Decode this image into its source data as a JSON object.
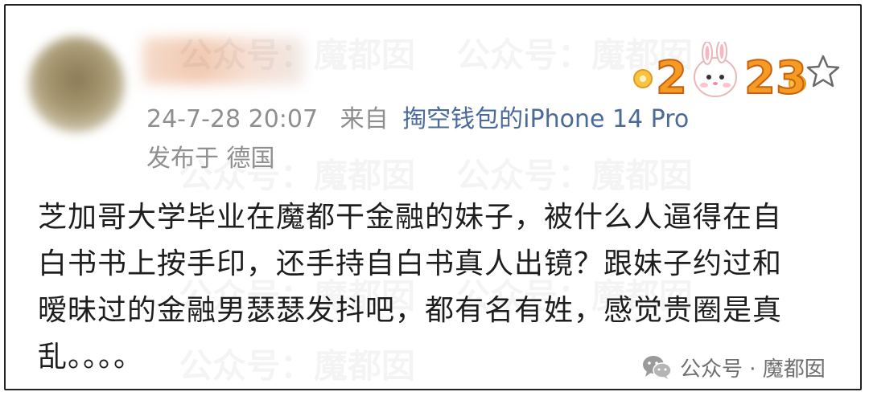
{
  "post": {
    "timestamp": "24-7-28 20:07",
    "source_prefix": "来自",
    "source_device": "掏空钱包的iPhone 14 Pro",
    "location": "发布于 德国",
    "content_lines": [
      "芝加哥大学毕业在魔都干金融的妹子，被什么人逼得在自",
      "白书书上按手印，还手持自白书真人出镜？跟妹子约过和",
      "暧昧过的金融男瑟瑟发抖吧，都有名有姓，感觉贵圈是真",
      "乱。。。。"
    ]
  },
  "watermark": {
    "text": "公众号：魔都囡"
  },
  "footer": {
    "label": "公众号 · 魔都囡"
  },
  "icons": {
    "badge": "year-2023-rabbit-badge-icon",
    "star": "star-outline-icon",
    "wechat": "wechat-icon"
  },
  "colors": {
    "meta_text": "#8f8f8f",
    "link": "#4a6a9a",
    "body_text": "#1e1e1e",
    "badge_orange": "#f59a23"
  }
}
